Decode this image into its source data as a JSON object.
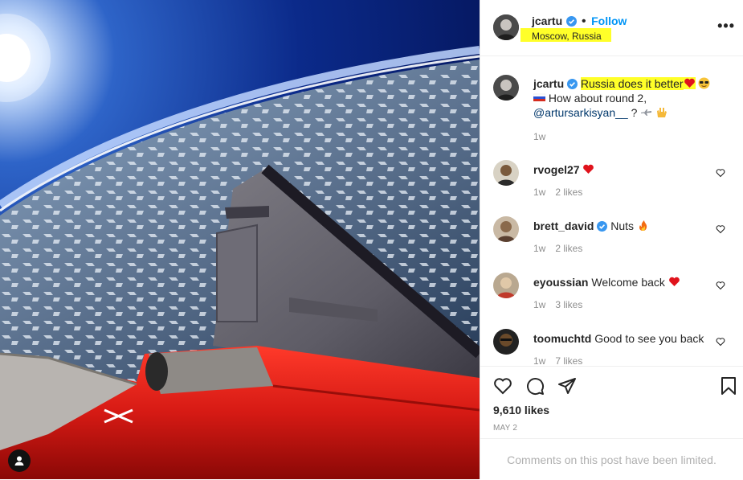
{
  "header": {
    "username": "jcartu",
    "follow_label": "Follow",
    "location": "Moscow, Russia",
    "more_label": "•••"
  },
  "caption": {
    "username": "jcartu",
    "highlight_text": "Russia does it better",
    "line2": "How about round 2,",
    "mention": "@artursarkisyan__",
    "after_mention": "?",
    "time": "1w"
  },
  "comments": [
    {
      "username": "rvogel27",
      "text": "",
      "time": "1w",
      "likes": "2 likes",
      "verified": false,
      "emoji": "heart"
    },
    {
      "username": "brett_david",
      "text": "Nuts",
      "time": "1w",
      "likes": "2 likes",
      "verified": true,
      "emoji": "fire"
    },
    {
      "username": "eyoussian",
      "text": "Welcome back",
      "time": "1w",
      "likes": "3 likes",
      "verified": false,
      "emoji": "heart"
    },
    {
      "username": "toomuchtd",
      "text": "Good to see you back",
      "time": "1w",
      "likes": "7 likes",
      "verified": false,
      "emoji": ""
    }
  ],
  "footer": {
    "likes_count": "9,610 likes",
    "date": "MAY 2",
    "limited_text": "Comments on this post have been limited."
  },
  "colors": {
    "link_blue": "#0095f6",
    "highlight": "#ffff29",
    "heart_red": "#ed4956"
  },
  "icons": [
    "verified-badge-icon",
    "heart-icon",
    "comment-icon",
    "share-icon",
    "save-icon",
    "more-icon",
    "user-tag-icon"
  ]
}
